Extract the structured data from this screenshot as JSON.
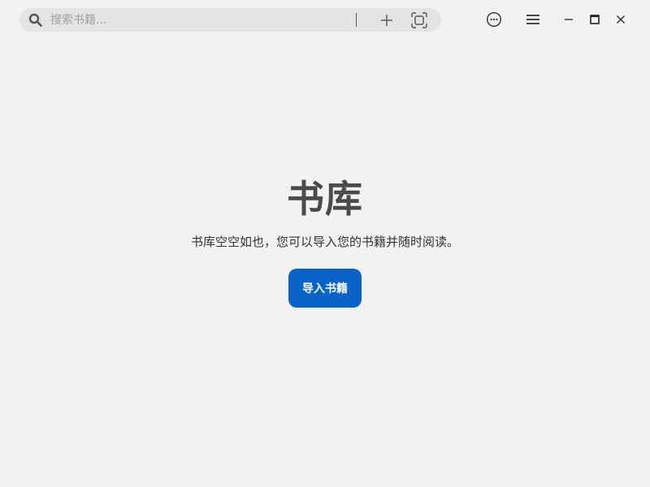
{
  "header": {
    "search": {
      "placeholder": "搜索书籍...",
      "value": ""
    },
    "icons": {
      "search": "search-icon",
      "add": "plus-icon",
      "scan": "scan-icon",
      "more": "more-circle-icon",
      "menu": "hamburger-menu-icon",
      "minimize": "minimize-icon",
      "maximize": "maximize-icon",
      "close": "close-icon"
    }
  },
  "main": {
    "title": "书库",
    "empty_message": "书库空空如也，您可以导入您的书籍并随时阅读。",
    "import_button_label": "导入书籍"
  },
  "colors": {
    "background": "#f2f2f2",
    "search_bg": "#e4e4e4",
    "accent": "#0a63c9",
    "title_text": "#4a4a4a"
  }
}
